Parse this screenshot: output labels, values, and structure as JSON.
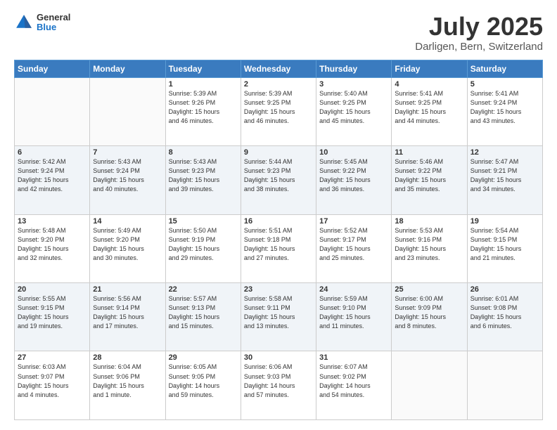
{
  "header": {
    "logo_general": "General",
    "logo_blue": "Blue",
    "month": "July 2025",
    "location": "Darligen, Bern, Switzerland"
  },
  "days_of_week": [
    "Sunday",
    "Monday",
    "Tuesday",
    "Wednesday",
    "Thursday",
    "Friday",
    "Saturday"
  ],
  "weeks": [
    [
      {
        "day": "",
        "info": ""
      },
      {
        "day": "",
        "info": ""
      },
      {
        "day": "1",
        "info": "Sunrise: 5:39 AM\nSunset: 9:26 PM\nDaylight: 15 hours\nand 46 minutes."
      },
      {
        "day": "2",
        "info": "Sunrise: 5:39 AM\nSunset: 9:25 PM\nDaylight: 15 hours\nand 46 minutes."
      },
      {
        "day": "3",
        "info": "Sunrise: 5:40 AM\nSunset: 9:25 PM\nDaylight: 15 hours\nand 45 minutes."
      },
      {
        "day": "4",
        "info": "Sunrise: 5:41 AM\nSunset: 9:25 PM\nDaylight: 15 hours\nand 44 minutes."
      },
      {
        "day": "5",
        "info": "Sunrise: 5:41 AM\nSunset: 9:24 PM\nDaylight: 15 hours\nand 43 minutes."
      }
    ],
    [
      {
        "day": "6",
        "info": "Sunrise: 5:42 AM\nSunset: 9:24 PM\nDaylight: 15 hours\nand 42 minutes."
      },
      {
        "day": "7",
        "info": "Sunrise: 5:43 AM\nSunset: 9:24 PM\nDaylight: 15 hours\nand 40 minutes."
      },
      {
        "day": "8",
        "info": "Sunrise: 5:43 AM\nSunset: 9:23 PM\nDaylight: 15 hours\nand 39 minutes."
      },
      {
        "day": "9",
        "info": "Sunrise: 5:44 AM\nSunset: 9:23 PM\nDaylight: 15 hours\nand 38 minutes."
      },
      {
        "day": "10",
        "info": "Sunrise: 5:45 AM\nSunset: 9:22 PM\nDaylight: 15 hours\nand 36 minutes."
      },
      {
        "day": "11",
        "info": "Sunrise: 5:46 AM\nSunset: 9:22 PM\nDaylight: 15 hours\nand 35 minutes."
      },
      {
        "day": "12",
        "info": "Sunrise: 5:47 AM\nSunset: 9:21 PM\nDaylight: 15 hours\nand 34 minutes."
      }
    ],
    [
      {
        "day": "13",
        "info": "Sunrise: 5:48 AM\nSunset: 9:20 PM\nDaylight: 15 hours\nand 32 minutes."
      },
      {
        "day": "14",
        "info": "Sunrise: 5:49 AM\nSunset: 9:20 PM\nDaylight: 15 hours\nand 30 minutes."
      },
      {
        "day": "15",
        "info": "Sunrise: 5:50 AM\nSunset: 9:19 PM\nDaylight: 15 hours\nand 29 minutes."
      },
      {
        "day": "16",
        "info": "Sunrise: 5:51 AM\nSunset: 9:18 PM\nDaylight: 15 hours\nand 27 minutes."
      },
      {
        "day": "17",
        "info": "Sunrise: 5:52 AM\nSunset: 9:17 PM\nDaylight: 15 hours\nand 25 minutes."
      },
      {
        "day": "18",
        "info": "Sunrise: 5:53 AM\nSunset: 9:16 PM\nDaylight: 15 hours\nand 23 minutes."
      },
      {
        "day": "19",
        "info": "Sunrise: 5:54 AM\nSunset: 9:15 PM\nDaylight: 15 hours\nand 21 minutes."
      }
    ],
    [
      {
        "day": "20",
        "info": "Sunrise: 5:55 AM\nSunset: 9:15 PM\nDaylight: 15 hours\nand 19 minutes."
      },
      {
        "day": "21",
        "info": "Sunrise: 5:56 AM\nSunset: 9:14 PM\nDaylight: 15 hours\nand 17 minutes."
      },
      {
        "day": "22",
        "info": "Sunrise: 5:57 AM\nSunset: 9:13 PM\nDaylight: 15 hours\nand 15 minutes."
      },
      {
        "day": "23",
        "info": "Sunrise: 5:58 AM\nSunset: 9:11 PM\nDaylight: 15 hours\nand 13 minutes."
      },
      {
        "day": "24",
        "info": "Sunrise: 5:59 AM\nSunset: 9:10 PM\nDaylight: 15 hours\nand 11 minutes."
      },
      {
        "day": "25",
        "info": "Sunrise: 6:00 AM\nSunset: 9:09 PM\nDaylight: 15 hours\nand 8 minutes."
      },
      {
        "day": "26",
        "info": "Sunrise: 6:01 AM\nSunset: 9:08 PM\nDaylight: 15 hours\nand 6 minutes."
      }
    ],
    [
      {
        "day": "27",
        "info": "Sunrise: 6:03 AM\nSunset: 9:07 PM\nDaylight: 15 hours\nand 4 minutes."
      },
      {
        "day": "28",
        "info": "Sunrise: 6:04 AM\nSunset: 9:06 PM\nDaylight: 15 hours\nand 1 minute."
      },
      {
        "day": "29",
        "info": "Sunrise: 6:05 AM\nSunset: 9:05 PM\nDaylight: 14 hours\nand 59 minutes."
      },
      {
        "day": "30",
        "info": "Sunrise: 6:06 AM\nSunset: 9:03 PM\nDaylight: 14 hours\nand 57 minutes."
      },
      {
        "day": "31",
        "info": "Sunrise: 6:07 AM\nSunset: 9:02 PM\nDaylight: 14 hours\nand 54 minutes."
      },
      {
        "day": "",
        "info": ""
      },
      {
        "day": "",
        "info": ""
      }
    ]
  ]
}
